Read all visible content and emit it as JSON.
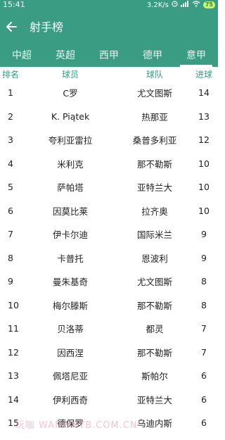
{
  "status": {
    "time": "15:41",
    "speed": "3.2K/s",
    "battery": "75"
  },
  "appbar": {
    "title": "射手榜"
  },
  "tabs": [
    {
      "label": "中超"
    },
    {
      "label": "英超"
    },
    {
      "label": "西甲"
    },
    {
      "label": "德甲"
    },
    {
      "label": "意甲"
    }
  ],
  "active_tab": 4,
  "table": {
    "headers": {
      "rank": "排名",
      "player": "球员",
      "team": "球队",
      "goals": "进球"
    },
    "rows": [
      {
        "rank": "1",
        "player": "C罗",
        "team": "尤文图斯",
        "goals": "14"
      },
      {
        "rank": "2",
        "player": "K. Piątek",
        "team": "热那亚",
        "goals": "13"
      },
      {
        "rank": "3",
        "player": "夸利亚雷拉",
        "team": "桑普多利亚",
        "goals": "12"
      },
      {
        "rank": "4",
        "player": "米利克",
        "team": "那不勒斯",
        "goals": "10"
      },
      {
        "rank": "5",
        "player": "萨帕塔",
        "team": "亚特兰大",
        "goals": "10"
      },
      {
        "rank": "6",
        "player": "因莫比莱",
        "team": "拉齐奥",
        "goals": "10"
      },
      {
        "rank": "7",
        "player": "伊卡尔迪",
        "team": "国际米兰",
        "goals": "9"
      },
      {
        "rank": "8",
        "player": "卡普托",
        "team": "恩波利",
        "goals": "9"
      },
      {
        "rank": "9",
        "player": "曼朱基奇",
        "team": "尤文图斯",
        "goals": "8"
      },
      {
        "rank": "10",
        "player": "梅尔滕斯",
        "team": "那不勒斯",
        "goals": "8"
      },
      {
        "rank": "11",
        "player": "贝洛蒂",
        "team": "都灵",
        "goals": "7"
      },
      {
        "rank": "12",
        "player": "因西涅",
        "team": "那不勒斯",
        "goals": "7"
      },
      {
        "rank": "13",
        "player": "佩塔尼亚",
        "team": "斯帕尔",
        "goals": "6"
      },
      {
        "rank": "14",
        "player": "伊利西奇",
        "team": "亚特兰大",
        "goals": "6"
      },
      {
        "rank": "15",
        "player": "德保罗",
        "team": "乌迪内斯",
        "goals": "6"
      }
    ]
  },
  "watermark": "玩咖 WANBWYB.COM.CN",
  "colors": {
    "primary": "#3a9c83",
    "text": "#222222"
  }
}
